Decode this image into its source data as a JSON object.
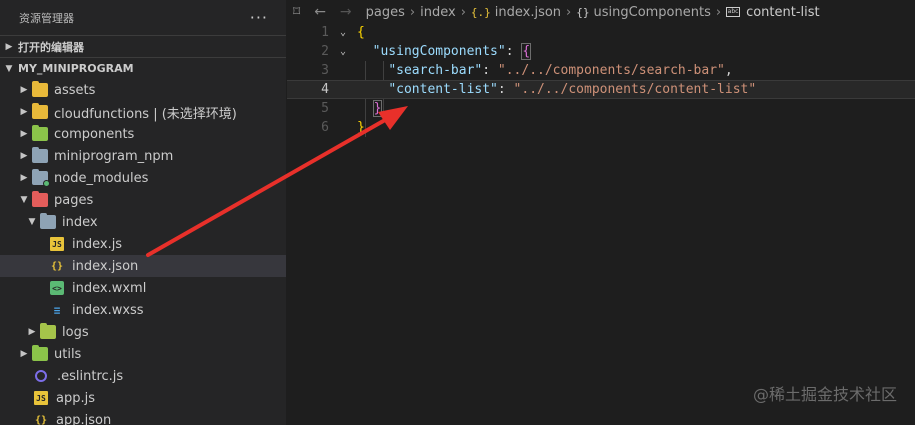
{
  "explorer": {
    "title": "资源管理器",
    "more": "···",
    "open_editors": "打开的编辑器",
    "project": "MY_MINIPROGRAM",
    "tree": [
      {
        "label": "assets"
      },
      {
        "label": "cloudfunctions | (未选择环境)"
      },
      {
        "label": "components"
      },
      {
        "label": "miniprogram_npm"
      },
      {
        "label": "node_modules"
      },
      {
        "label": "pages"
      },
      {
        "label": "index"
      },
      {
        "label": "index.js"
      },
      {
        "label": "index.json"
      },
      {
        "label": "index.wxml"
      },
      {
        "label": "index.wxss"
      },
      {
        "label": "logs"
      },
      {
        "label": "utils"
      },
      {
        "label": ".eslintrc.js"
      },
      {
        "label": "app.js"
      },
      {
        "label": "app.json"
      }
    ]
  },
  "breadcrumb": {
    "items": [
      "pages",
      "index",
      "index.json",
      "usingComponents",
      "content-list"
    ]
  },
  "code": {
    "line_numbers": [
      "1",
      "2",
      "3",
      "4",
      "5",
      "6"
    ],
    "l1_brace": "{",
    "l2_key": "\"usingComponents\"",
    "l2_colon": ": ",
    "l2_brace": "{",
    "l3_key": "\"search-bar\"",
    "l3_colon": ": ",
    "l3_val": "\"../../components/search-bar\"",
    "l3_comma": ",",
    "l4_key": "\"content-list\"",
    "l4_colon": ": ",
    "l4_val": "\"../../components/content-list\"",
    "l5_brace": "}",
    "l6_brace": "}"
  },
  "watermark": "@稀土掘金技术社区",
  "colors": {
    "accent_arrow": "#e8302a"
  }
}
